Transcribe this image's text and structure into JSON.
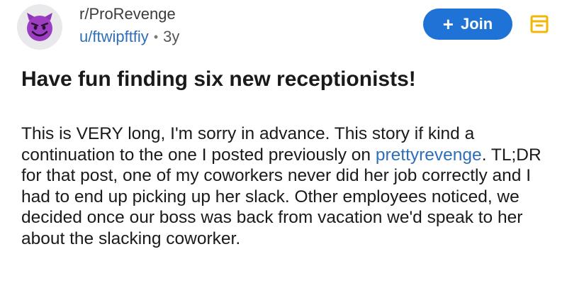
{
  "post": {
    "subreddit": "r/ProRevenge",
    "username": "u/ftwipftfiy",
    "separator": "•",
    "age": "3y",
    "join_label": "Join",
    "title": "Have fun finding six new receptionists!",
    "body_text_1": "This is VERY long, I'm sorry in advance. This story if kind a continuation to the one I posted previously on ",
    "body_link": "prettyrevenge",
    "body_text_2": ". TL;DR for that post, one of my coworkers never did her job correctly and I had to end up picking up her slack. Other employees noticed, we decided once our boss was back from vacation we'd speak to her about the slacking coworker."
  },
  "icons": {
    "avatar": "purple-devil-emoji-icon",
    "join": "plus-icon",
    "save": "bookmark-icon"
  },
  "colors": {
    "accent": "#1f73d6",
    "link": "#2f6fb8",
    "save_icon": "#f2b705",
    "avatar": "#9b3ec2"
  }
}
